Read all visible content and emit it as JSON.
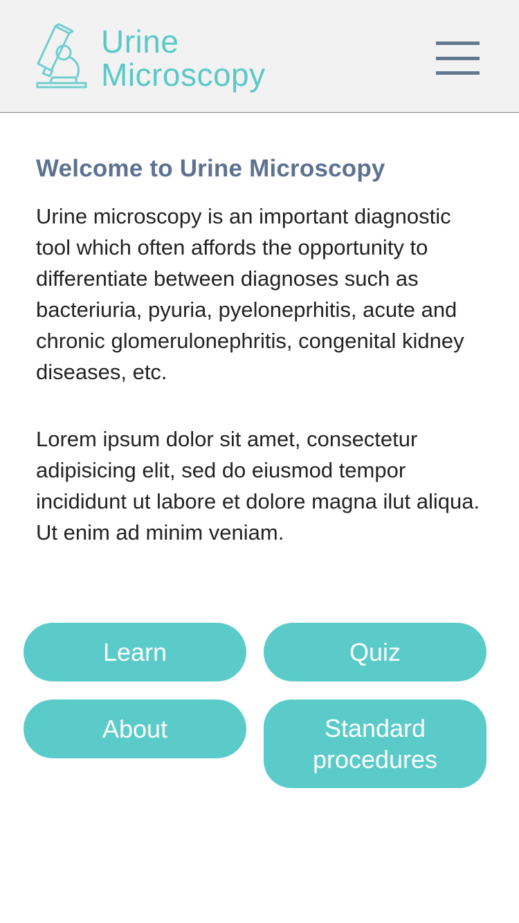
{
  "header": {
    "logo_icon": "microscope-icon",
    "title_line1": "Urine",
    "title_line2": "Microscopy",
    "menu_icon": "hamburger-menu-icon"
  },
  "main": {
    "heading": "Welcome to Urine Microscopy",
    "paragraph1": "Urine microscopy is an important diagnostic tool which often affords the opportunity to differentiate between diagnoses such as bacteriuria, pyuria, pyeloneprhitis, acute and chronic glomerulonephritis, congenital kidney diseases, etc.",
    "paragraph2": "Lorem ipsum dolor sit amet, consectetur adipisicing elit, sed do eiusmod tempor incididunt ut labore et dolore magna ilut aliqua. Ut enim ad minim veniam."
  },
  "buttons": {
    "learn": "Learn",
    "quiz": "Quiz",
    "about": "About",
    "standard_procedures": "Standard procedures"
  },
  "colors": {
    "accent": "#5bcbca",
    "heading": "#5c7290",
    "header_background": "#f2f2f2",
    "menu": "#62788f"
  }
}
